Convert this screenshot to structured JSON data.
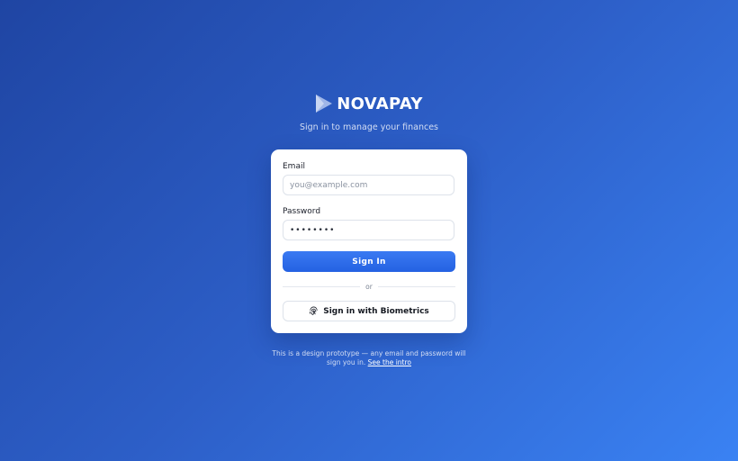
{
  "brand": {
    "name": "NOVAPAY",
    "logo_icon": "play-arrow-logo-icon",
    "tagline": "Sign in to manage your finances"
  },
  "form": {
    "email": {
      "label": "Email",
      "placeholder": "you@example.com",
      "value": ""
    },
    "password": {
      "label": "Password",
      "value": "••••••••"
    },
    "sign_in_label": "Sign In",
    "divider_text": "or",
    "biometrics": {
      "label": "Sign in with Biometrics",
      "icon": "fingerprint-icon"
    }
  },
  "footer": {
    "text": "This is a design prototype — any email and password will sign you in.",
    "link_text": "See the intro"
  },
  "colors": {
    "background_start": "#1f45a3",
    "background_end": "#3a82f3",
    "primary_button": "#2d6ae8",
    "card": "#ffffff"
  }
}
